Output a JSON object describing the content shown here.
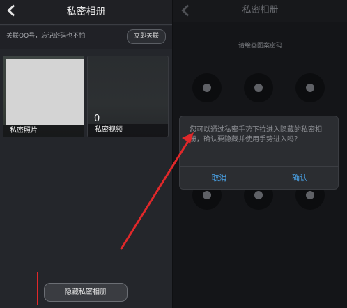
{
  "left_screen": {
    "title": "私密相册",
    "notice_text": "关联QQ号，忘记密码也不怕",
    "link_button": "立即关联",
    "albums": [
      {
        "label": "私密照片"
      },
      {
        "label": "私密视频",
        "count": "0"
      }
    ],
    "hide_button": "隐藏私密相册"
  },
  "right_screen": {
    "title": "私密相册",
    "pattern_hint": "请绘画图案密码",
    "dialog": {
      "message": "您可以通过私密手势下拉进入隐藏的私密相册，确认要隐藏并使用手势进入吗？",
      "cancel": "取消",
      "confirm": "确认"
    }
  },
  "colors": {
    "annotation_red": "#e0282a",
    "dialog_button": "#4aa3e8"
  }
}
